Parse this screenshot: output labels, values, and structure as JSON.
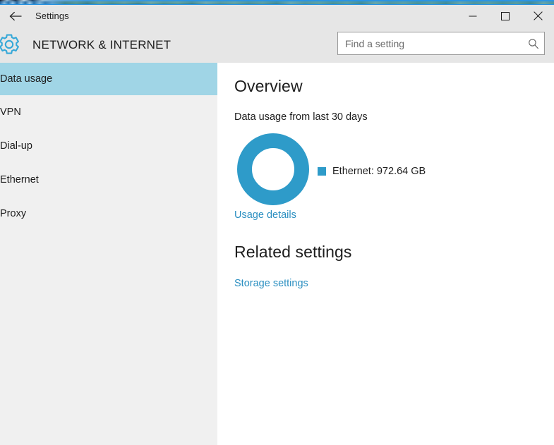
{
  "window": {
    "title": "Settings",
    "back_icon": "back-arrow-icon",
    "controls": {
      "minimize": "minimize-icon",
      "maximize": "maximize-icon",
      "close": "close-icon"
    }
  },
  "header": {
    "icon": "gear-icon",
    "category": "NETWORK & INTERNET"
  },
  "search": {
    "placeholder": "Find a setting",
    "value": "",
    "icon": "search-icon"
  },
  "sidebar": {
    "selected": "Data usage",
    "items": [
      {
        "label": "Data usage",
        "selected": true
      },
      {
        "label": "VPN",
        "selected": false
      },
      {
        "label": "Dial-up",
        "selected": false
      },
      {
        "label": "Ethernet",
        "selected": false
      },
      {
        "label": "Proxy",
        "selected": false
      }
    ]
  },
  "main": {
    "overview_heading": "Overview",
    "overview_subtitle": "Data usage from last 30 days",
    "legend_label": "Ethernet: 972.64 GB",
    "usage_details_link": "Usage details",
    "related_heading": "Related settings",
    "storage_settings_link": "Storage settings"
  },
  "colors": {
    "accent_blue": "#2b94e2",
    "donut_blue": "#2e9bc9",
    "link_blue": "#2b8fc1",
    "selection_blue": "#a0d5e6",
    "sidebar_bg": "#f0f0f0",
    "header_bg": "#e6e6e6",
    "content_bg": "#ffffff",
    "text": "#1d1d1d"
  },
  "chart_data": {
    "type": "pie",
    "title": "Data usage from last 30 days",
    "subtype": "donut",
    "categories": [
      "Ethernet"
    ],
    "values": [
      972.64
    ],
    "unit": "GB",
    "percentages": [
      100
    ],
    "labels": [
      "Ethernet: 972.64 GB"
    ],
    "colors": [
      "#2e9bc9"
    ],
    "legend_position": "right",
    "grid": false,
    "xlabel": "",
    "ylabel": ""
  }
}
